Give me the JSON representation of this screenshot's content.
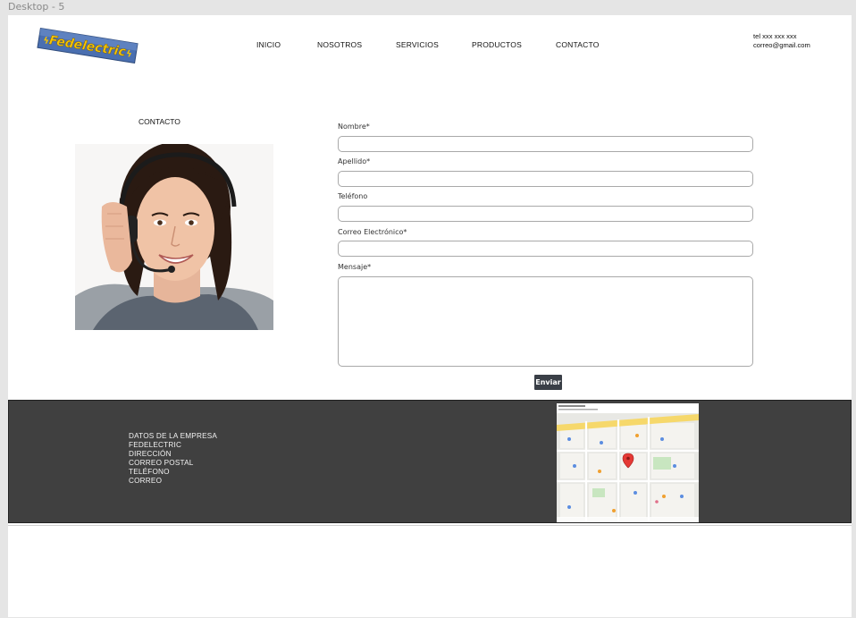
{
  "frame": {
    "label": "Desktop - 5"
  },
  "brand": {
    "logo_text": "Fedelectric"
  },
  "nav": {
    "items": [
      {
        "label": "INICIO"
      },
      {
        "label": "NOSOTROS"
      },
      {
        "label": "SERVICIOS"
      },
      {
        "label": "PRODUCTOS"
      },
      {
        "label": "CONTACTO"
      }
    ]
  },
  "header_contact": {
    "phone": "tel xxx xxx xxx",
    "email": "correo@gmail.com"
  },
  "main": {
    "section_title": "CONTACTO"
  },
  "form": {
    "fields": [
      {
        "label": "Nombre*",
        "value": ""
      },
      {
        "label": "Apellido*",
        "value": ""
      },
      {
        "label": "Teléfono",
        "value": ""
      },
      {
        "label": "Correo Electrónico*",
        "value": ""
      },
      {
        "label": "Mensaje*",
        "value": ""
      }
    ],
    "submit_label": "Enviar"
  },
  "footer": {
    "lines": [
      "DATOS DE LA EMPRESA",
      "FEDELECTRIC",
      "DIRECCIÓN",
      "CORREO POSTAL",
      "TELÉFONO",
      "CORREO"
    ]
  },
  "colors": {
    "footer_bg": "#404040",
    "button_bg": "#3a3f47",
    "logo_bg": "#4a6fb0",
    "logo_text": "#f5c400"
  }
}
